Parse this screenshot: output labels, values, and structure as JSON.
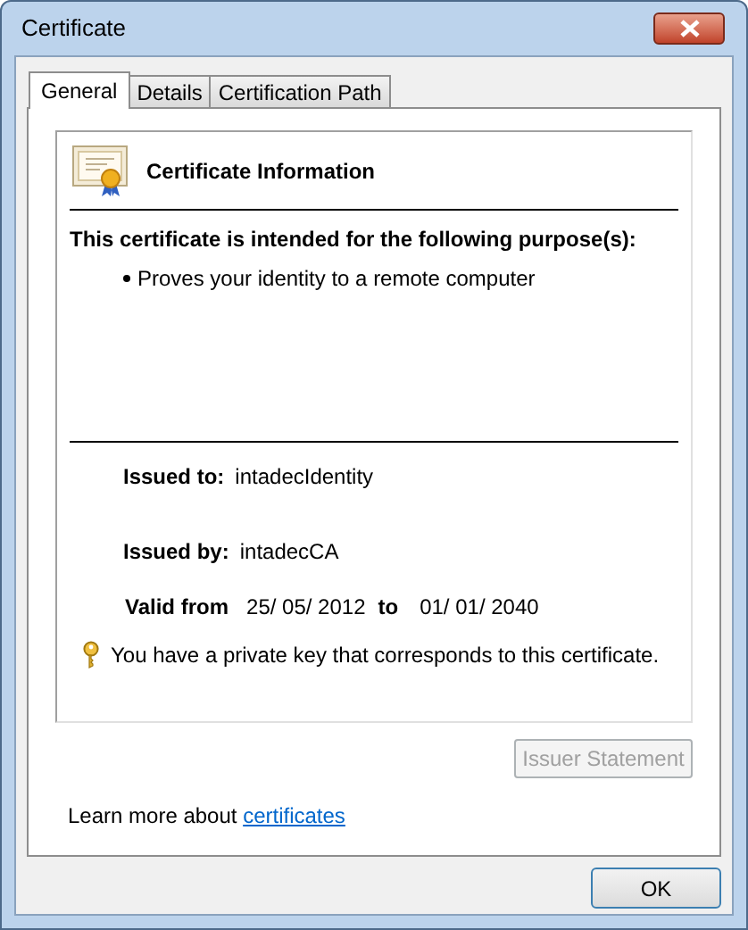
{
  "window": {
    "title": "Certificate"
  },
  "tabs": [
    {
      "label": "General",
      "selected": true
    },
    {
      "label": "Details",
      "selected": false
    },
    {
      "label": "Certification Path",
      "selected": false
    }
  ],
  "certificate": {
    "heading": "Certificate Information",
    "purpose_heading": "This certificate is intended for the following purpose(s):",
    "purposes": [
      "Proves your identity to a remote computer"
    ],
    "fields": [
      {
        "label": "Issued to:",
        "value": "intadecIdentity"
      },
      {
        "label": "Issued by:",
        "value": "intadecCA"
      }
    ],
    "validity": {
      "from_label": "Valid from",
      "from": "25/ 05/ 2012",
      "to_label": "to",
      "to": "01/ 01/ 2040"
    },
    "private_key_note": "You have a private key that corresponds to this certificate."
  },
  "issuer_statement_button": {
    "label": "Issuer Statement",
    "disabled": true
  },
  "learn_more": {
    "text": "Learn more about",
    "link": "certificates"
  },
  "buttons": [
    {
      "label": "OK",
      "disabled": false
    }
  ]
}
